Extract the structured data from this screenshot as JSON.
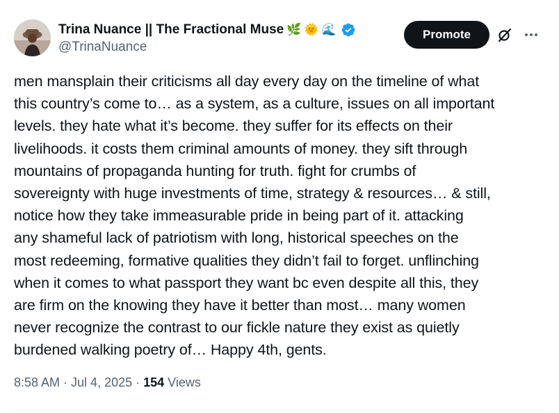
{
  "author": {
    "display_name": "Trina Nuance || The Fractional Muse",
    "emojis": [
      "🌿",
      "🌞",
      "🌊"
    ],
    "handle": "@TrinaNuance",
    "verified_color": "#1d9bf0"
  },
  "actions": {
    "promote_label": "Promote"
  },
  "tweet": {
    "lines": [
      "men mansplain their criticisms all day every day on the timeline of what",
      "this country’s come to… as a system, as a culture, issues on all important",
      "levels. they hate what it’s become. they suffer for its effects on their",
      "livelihoods. it costs them criminal amounts of money. they sift through",
      "mountains of propaganda hunting for truth. fight for crumbs of",
      "sovereignty with huge investments of time, strategy & resources… & still,",
      "notice how they take immeasurable pride in being part of it. attacking",
      "any shameful lack of patriotism with long, historical speeches on the",
      "most redeeming, formative qualities they didn’t fail to forget. unflinching",
      "when it comes to what passport they want bc even despite all this, they",
      "are firm on the knowing they have it better than most… many women",
      "never recognize the contrast to our fickle nature they exist as quietly",
      "burdened walking poetry of… Happy 4th, gents."
    ]
  },
  "meta": {
    "time": "8:58 AM",
    "separator": "·",
    "date": "Jul 4, 2025",
    "views_count": "154",
    "views_label": "Views"
  }
}
